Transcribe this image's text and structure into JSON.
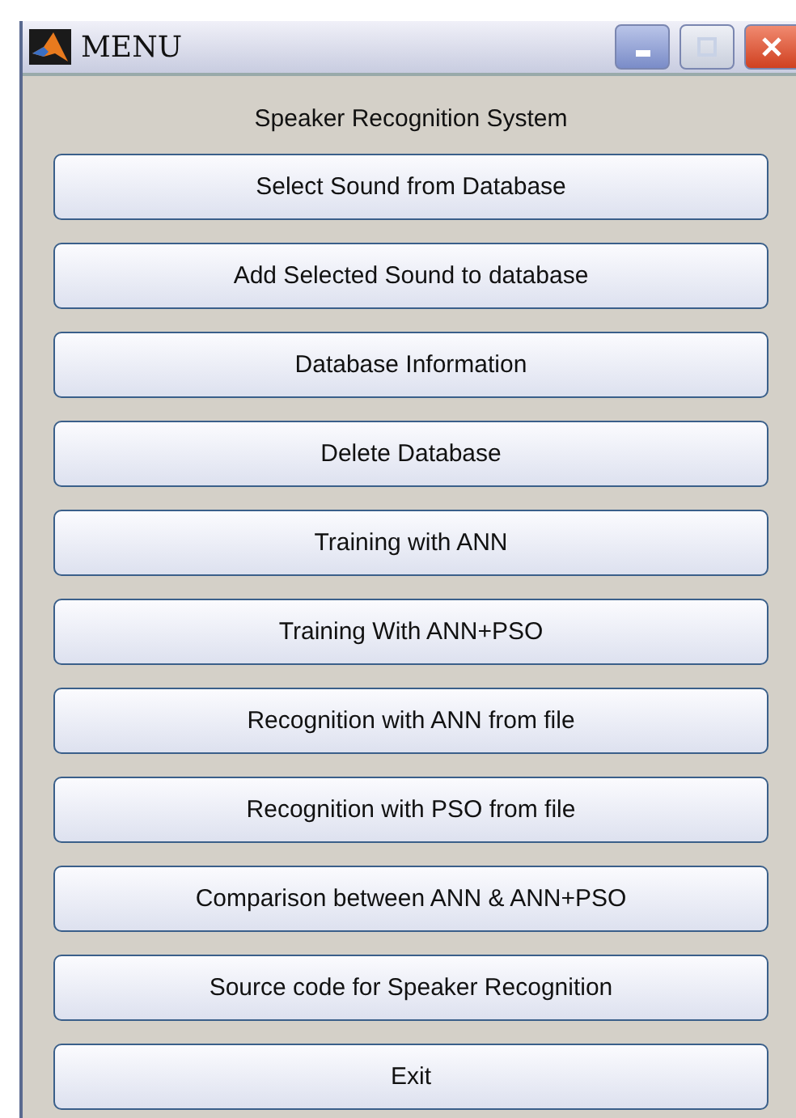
{
  "window": {
    "title": "MENU"
  },
  "heading": "Speaker Recognition System",
  "buttons": [
    "Select Sound from Database",
    "Add Selected Sound to database",
    "Database Information",
    "Delete Database",
    "Training with ANN",
    "Training With ANN+PSO",
    "Recognition with ANN from file",
    "Recognition with PSO from file",
    "Comparison between ANN & ANN+PSO",
    "Source code for Speaker Recognition",
    "Exit"
  ]
}
